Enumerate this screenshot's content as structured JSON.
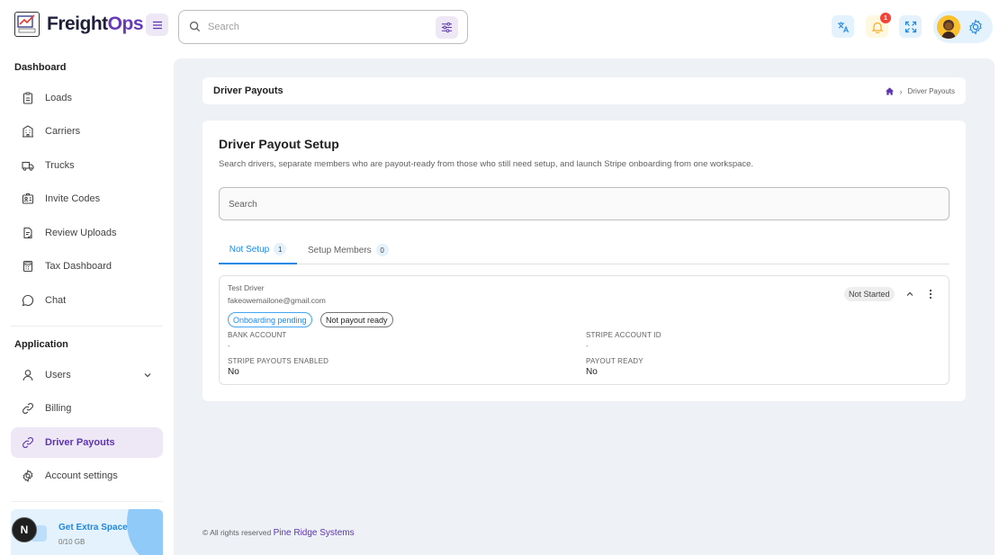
{
  "app": {
    "name_main": "Freight",
    "name_accent": "Ops",
    "logo_caption": "FreightOps"
  },
  "header": {
    "search_placeholder": "Search",
    "notification_count": "1",
    "icons": [
      "menu-icon",
      "search-icon",
      "filter-icon",
      "translate-icon",
      "bell-icon",
      "fullscreen-icon",
      "gear-icon"
    ]
  },
  "sidebar": {
    "dashboard_title": "Dashboard",
    "dashboard_items": [
      {
        "label": "Loads",
        "icon": "clipboard-icon"
      },
      {
        "label": "Carriers",
        "icon": "building-icon"
      },
      {
        "label": "Trucks",
        "icon": "truck-icon"
      },
      {
        "label": "Invite Codes",
        "icon": "id-card-icon"
      },
      {
        "label": "Review Uploads",
        "icon": "document-check-icon"
      },
      {
        "label": "Tax Dashboard",
        "icon": "calculator-icon"
      },
      {
        "label": "Chat",
        "icon": "chat-icon"
      }
    ],
    "application_title": "Application",
    "application_items": [
      {
        "label": "Users",
        "icon": "user-icon"
      },
      {
        "label": "Billing",
        "icon": "link-icon"
      },
      {
        "label": "Driver Payouts",
        "icon": "link-icon",
        "active": true
      },
      {
        "label": "Account settings",
        "icon": "gear-icon"
      }
    ],
    "extra_space": {
      "title": "Get Extra Space",
      "usage": "0/10 GB"
    },
    "n_badge": "N"
  },
  "breadcrumb": {
    "title": "Driver Payouts",
    "current": "Driver Payouts"
  },
  "page": {
    "title": "Driver Payout Setup",
    "description": "Search drivers, separate members who are payout-ready from those who still need setup, and launch Stripe onboarding from one workspace.",
    "search_placeholder": "Search",
    "tabs": [
      {
        "label": "Not Setup",
        "count": "1",
        "active": true
      },
      {
        "label": "Setup Members",
        "count": "0",
        "active": false
      }
    ],
    "member": {
      "name": "Test Driver",
      "email": "fakeowemailone@gmail.com",
      "chips": [
        "Onboarding pending",
        "Not payout ready"
      ],
      "status": "Not Started",
      "fields": {
        "bank_account_label": "BANK ACCOUNT",
        "bank_account_value": "-",
        "stripe_account_id_label": "STRIPE ACCOUNT ID",
        "stripe_account_id_value": "-",
        "stripe_payouts_enabled_label": "STRIPE PAYOUTS ENABLED",
        "stripe_payouts_enabled_value": "No",
        "payout_ready_label": "PAYOUT READY",
        "payout_ready_value": "No"
      }
    }
  },
  "footer": {
    "text": "© All rights reserved",
    "link": "Pine Ridge Systems"
  },
  "colors": {
    "accent": "#673ab7",
    "primary_blue": "#1e88e5",
    "main_bg": "#eef2f6",
    "active_nav_bg": "#ede7f6"
  }
}
